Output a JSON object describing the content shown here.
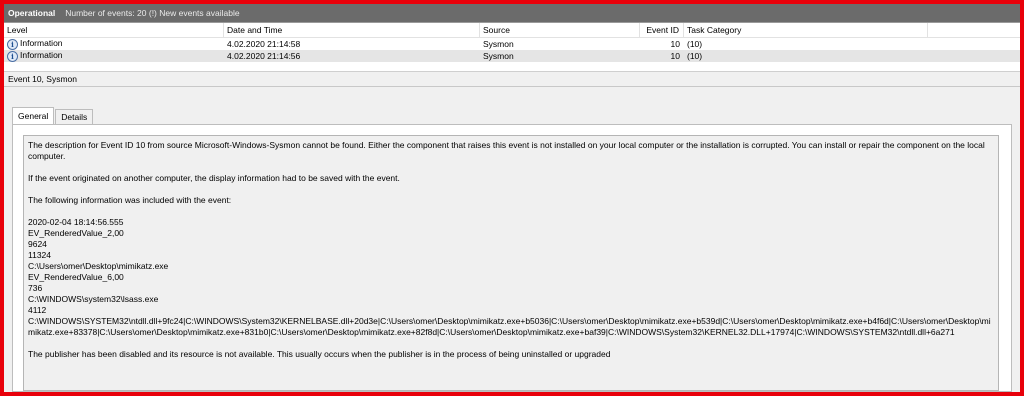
{
  "titlebar": {
    "log_name": "Operational",
    "event_count": "Number of events: 20 (!) New events available"
  },
  "table": {
    "headers": {
      "level": "Level",
      "date": "Date and Time",
      "source": "Source",
      "event_id": "Event ID",
      "task": "Task Category"
    },
    "rows": [
      {
        "level": "Information",
        "date": "4.02.2020 21:14:58",
        "source": "Sysmon",
        "event_id": "10",
        "task": "(10)"
      },
      {
        "level": "Information",
        "date": "4.02.2020 21:14:56",
        "source": "Sysmon",
        "event_id": "10",
        "task": "(10)"
      }
    ]
  },
  "event_header": "Event 10, Sysmon",
  "tabs": {
    "general": "General",
    "details": "Details"
  },
  "description": {
    "p1": "The description for Event ID 10 from source Microsoft-Windows-Sysmon cannot be found. Either the component that raises this event is not installed on your local computer or the installation is corrupted. You can install or repair the component on the local computer.",
    "p2": "If the event originated on another computer, the display information had to be saved with the event.",
    "p3": "The following information was included with the event:",
    "lines": [
      "2020-02-04 18:14:56.555",
      "EV_RenderedValue_2,00",
      "9624",
      "11324",
      "C:\\Users\\omer\\Desktop\\mimikatz.exe",
      "EV_RenderedValue_6,00",
      "736",
      "C:\\WINDOWS\\system32\\lsass.exe",
      "4112"
    ],
    "trace": "C:\\WINDOWS\\SYSTEM32\\ntdll.dll+9fc24|C:\\WINDOWS\\System32\\KERNELBASE.dll+20d3e|C:\\Users\\omer\\Desktop\\mimikatz.exe+b5036|C:\\Users\\omer\\Desktop\\mimikatz.exe+b539d|C:\\Users\\omer\\Desktop\\mimikatz.exe+b4f6d|C:\\Users\\omer\\Desktop\\mimikatz.exe+83378|C:\\Users\\omer\\Desktop\\mimikatz.exe+831b0|C:\\Users\\omer\\Desktop\\mimikatz.exe+82f8d|C:\\Users\\omer\\Desktop\\mimikatz.exe+baf39|C:\\WINDOWS\\System32\\KERNEL32.DLL+17974|C:\\WINDOWS\\SYSTEM32\\ntdll.dll+6a271",
    "p4": "The publisher has been disabled and its resource is not available. This usually occurs when the publisher is in the process of being uninstalled or upgraded"
  },
  "colors": {
    "frame": "#e8000a",
    "titlebar": "#6b6b6b",
    "selected_row": "#e5e5e5"
  },
  "icons": {
    "level": "information-icon"
  }
}
